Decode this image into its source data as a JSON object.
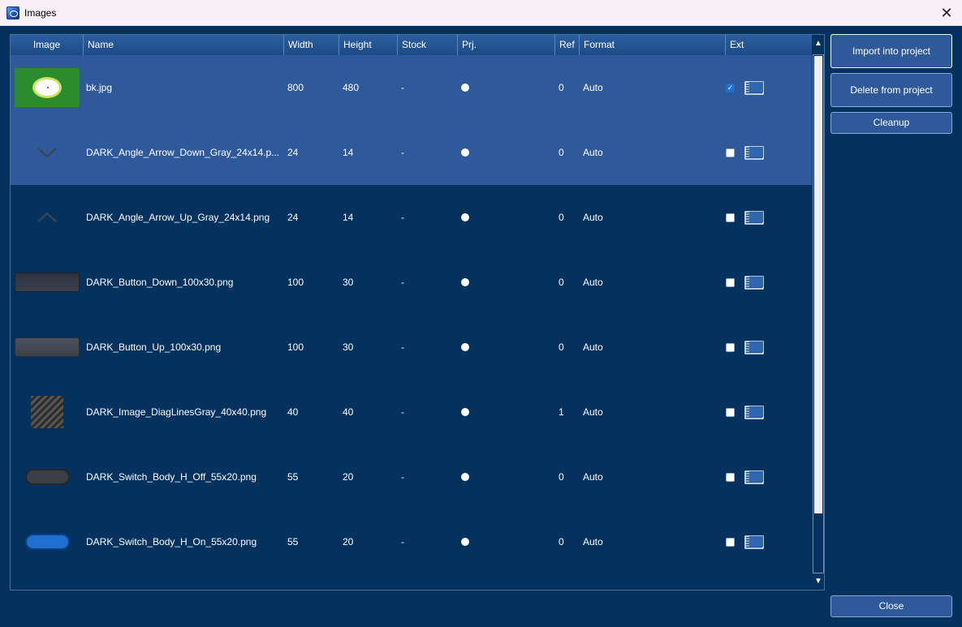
{
  "window": {
    "title": "Images",
    "close_glyph": "✕"
  },
  "columns": [
    "Image",
    "Name",
    "Width",
    "Height",
    "Stock",
    "Prj.",
    "Ref",
    "Format",
    "Ext"
  ],
  "rows": [
    {
      "thumb": "bk",
      "name": "bk.jpg",
      "width": "800",
      "height": "480",
      "stock": "-",
      "ref": "0",
      "format": "Auto",
      "ext": true,
      "selected": true
    },
    {
      "thumb": "arrow-down",
      "name": "DARK_Angle_Arrow_Down_Gray_24x14.p...",
      "width": "24",
      "height": "14",
      "stock": "-",
      "ref": "0",
      "format": "Auto",
      "ext": false,
      "selected": true
    },
    {
      "thumb": "arrow-up",
      "name": "DARK_Angle_Arrow_Up_Gray_24x14.png",
      "width": "24",
      "height": "14",
      "stock": "-",
      "ref": "0",
      "format": "Auto",
      "ext": false,
      "selected": false
    },
    {
      "thumb": "button-down",
      "name": "DARK_Button_Down_100x30.png",
      "width": "100",
      "height": "30",
      "stock": "-",
      "ref": "0",
      "format": "Auto",
      "ext": false,
      "selected": false
    },
    {
      "thumb": "button-up",
      "name": "DARK_Button_Up_100x30.png",
      "width": "100",
      "height": "30",
      "stock": "-",
      "ref": "0",
      "format": "Auto",
      "ext": false,
      "selected": false
    },
    {
      "thumb": "diag-lines",
      "name": "DARK_Image_DiagLinesGray_40x40.png",
      "width": "40",
      "height": "40",
      "stock": "-",
      "ref": "1",
      "format": "Auto",
      "ext": false,
      "selected": false
    },
    {
      "thumb": "switch-off",
      "name": "DARK_Switch_Body_H_Off_55x20.png",
      "width": "55",
      "height": "20",
      "stock": "-",
      "ref": "0",
      "format": "Auto",
      "ext": false,
      "selected": false
    },
    {
      "thumb": "switch-on",
      "name": "DARK_Switch_Body_H_On_55x20.png",
      "width": "55",
      "height": "20",
      "stock": "-",
      "ref": "0",
      "format": "Auto",
      "ext": false,
      "selected": false
    }
  ],
  "buttons": {
    "import": "Import into project",
    "delete": "Delete from project",
    "cleanup": "Cleanup",
    "close": "Close"
  },
  "colors": {
    "background": "#03325f",
    "header": "#2c5fa0",
    "selected_row": "#2e5a9c",
    "checkbox_on": "#1f70d6"
  }
}
